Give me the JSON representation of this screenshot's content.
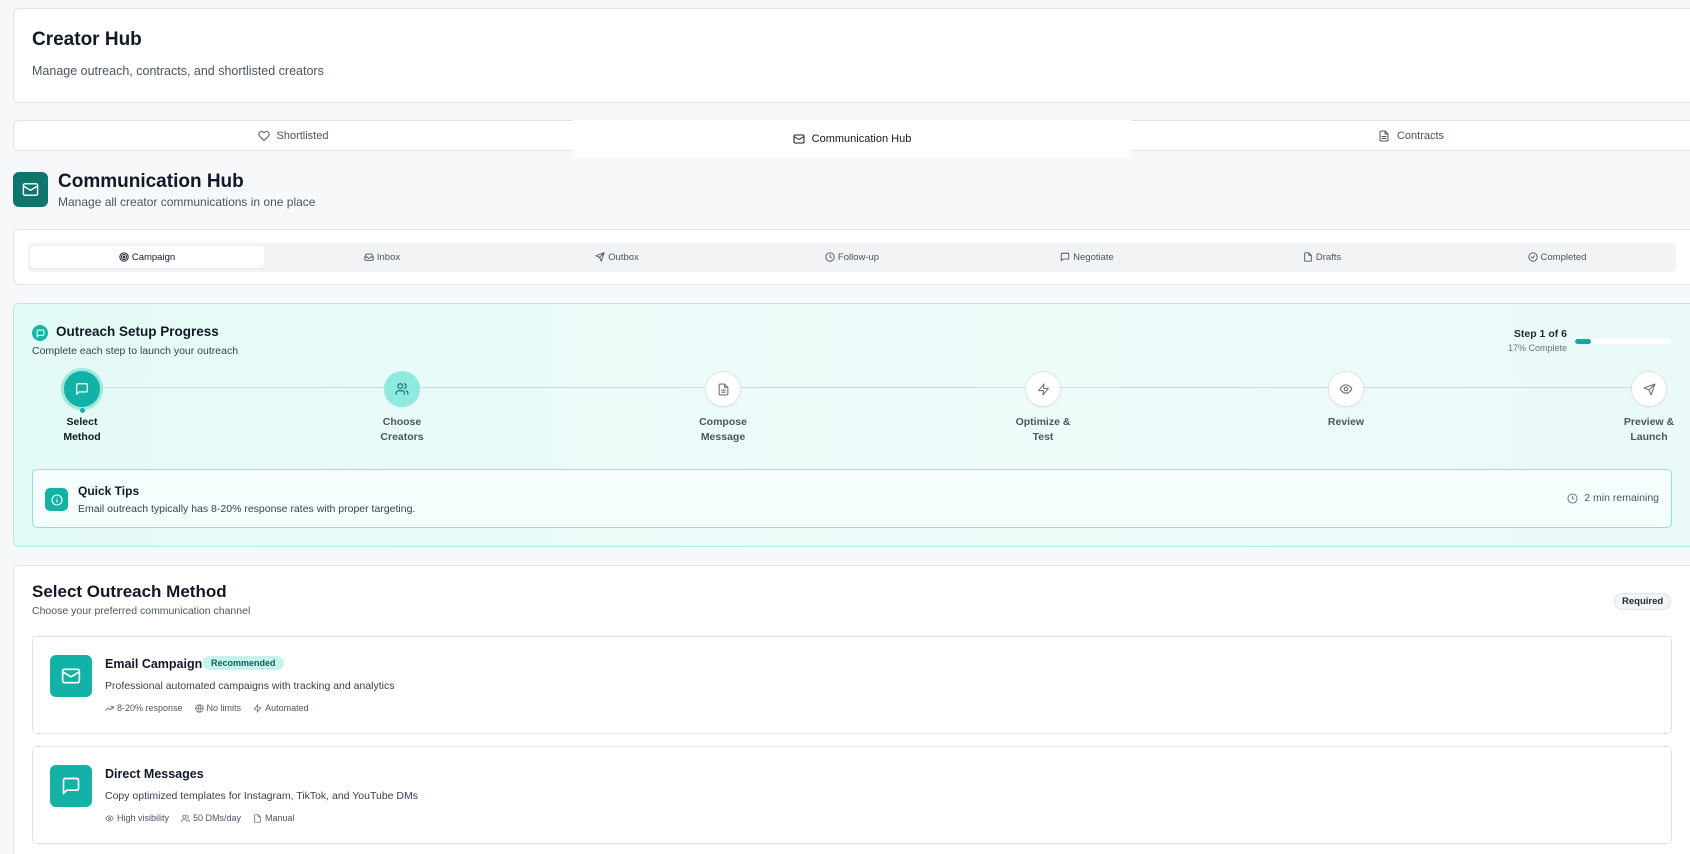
{
  "header": {
    "title": "Creator Hub",
    "subtitle": "Manage outreach, contracts, and shortlisted creators"
  },
  "top_tabs": [
    {
      "label": "Shortlisted",
      "icon": "heart-icon"
    },
    {
      "label": "Communication Hub",
      "icon": "mail-icon",
      "active": true
    },
    {
      "label": "Contracts",
      "icon": "file-icon"
    }
  ],
  "hub": {
    "title": "Communication Hub",
    "subtitle": "Manage all creator communications in one place"
  },
  "sub_tabs": [
    {
      "label": "Campaign",
      "icon": "target-icon",
      "active": true
    },
    {
      "label": "Inbox",
      "icon": "inbox-icon"
    },
    {
      "label": "Outbox",
      "icon": "send-icon"
    },
    {
      "label": "Follow-up",
      "icon": "clock-icon"
    },
    {
      "label": "Negotiate",
      "icon": "message-icon"
    },
    {
      "label": "Drafts",
      "icon": "file-icon"
    },
    {
      "label": "Completed",
      "icon": "check-circle-icon"
    }
  ],
  "progress": {
    "title": "Outreach Setup Progress",
    "subtitle": "Complete each step to launch your outreach",
    "step_label": "Step 1 of 6",
    "percent_label": "17% Complete",
    "percent": 17,
    "steps": [
      {
        "line1": "Select",
        "line2": "Method",
        "icon": "message-icon",
        "state": "current"
      },
      {
        "line1": "Choose",
        "line2": "Creators",
        "icon": "users-icon",
        "state": "next"
      },
      {
        "line1": "Compose",
        "line2": "Message",
        "icon": "file-icon",
        "state": "pending"
      },
      {
        "line1": "Optimize &",
        "line2": "Test",
        "icon": "zap-icon",
        "state": "pending"
      },
      {
        "line1": "Review",
        "line2": "",
        "icon": "eye-icon",
        "state": "pending"
      },
      {
        "line1": "Preview &",
        "line2": "Launch",
        "icon": "send-icon",
        "state": "pending"
      }
    ]
  },
  "tips": {
    "title": "Quick Tips",
    "text": "Email outreach typically has 8-20% response rates with proper targeting.",
    "remaining": "2 min remaining"
  },
  "method": {
    "title": "Select Outreach Method",
    "subtitle": "Choose your preferred communication channel",
    "required": "Required",
    "options": [
      {
        "title": "Email Campaign",
        "badge": "Recommended",
        "description": "Professional automated campaigns with tracking and analytics",
        "features": [
          {
            "label": "8-20% response",
            "icon": "trend-icon"
          },
          {
            "label": "No limits",
            "icon": "globe-icon"
          },
          {
            "label": "Automated",
            "icon": "zap-icon"
          }
        ]
      },
      {
        "title": "Direct Messages",
        "badge": "",
        "description": "Copy optimized templates for Instagram, TikTok, and YouTube DMs",
        "features": [
          {
            "label": "High visibility",
            "icon": "eye-icon"
          },
          {
            "label": "50 DMs/day",
            "icon": "users-icon"
          },
          {
            "label": "Manual",
            "icon": "file-icon"
          }
        ]
      }
    ]
  }
}
